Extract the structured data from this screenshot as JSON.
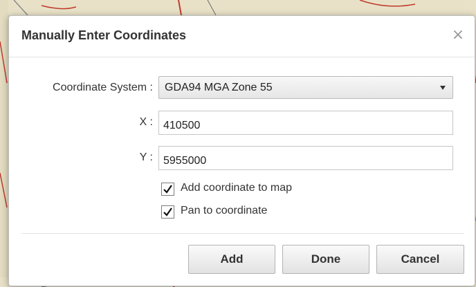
{
  "dialog": {
    "title": "Manually Enter Coordinates",
    "close_glyph": "×"
  },
  "form": {
    "coordinate_system_label": "Coordinate System :",
    "coordinate_system_value": "GDA94 MGA Zone 55",
    "x_label": "X :",
    "x_value": "410500",
    "y_label": "Y :",
    "y_value": "5955000",
    "add_to_map_label": "Add coordinate to map",
    "add_to_map_checked": true,
    "pan_label": "Pan to coordinate",
    "pan_checked": true
  },
  "buttons": {
    "add": "Add",
    "done": "Done",
    "cancel": "Cancel"
  },
  "colors": {
    "map_background": "#d9d2b6",
    "dialog_background": "#ffffff",
    "map_road_red": "#c0392b"
  }
}
